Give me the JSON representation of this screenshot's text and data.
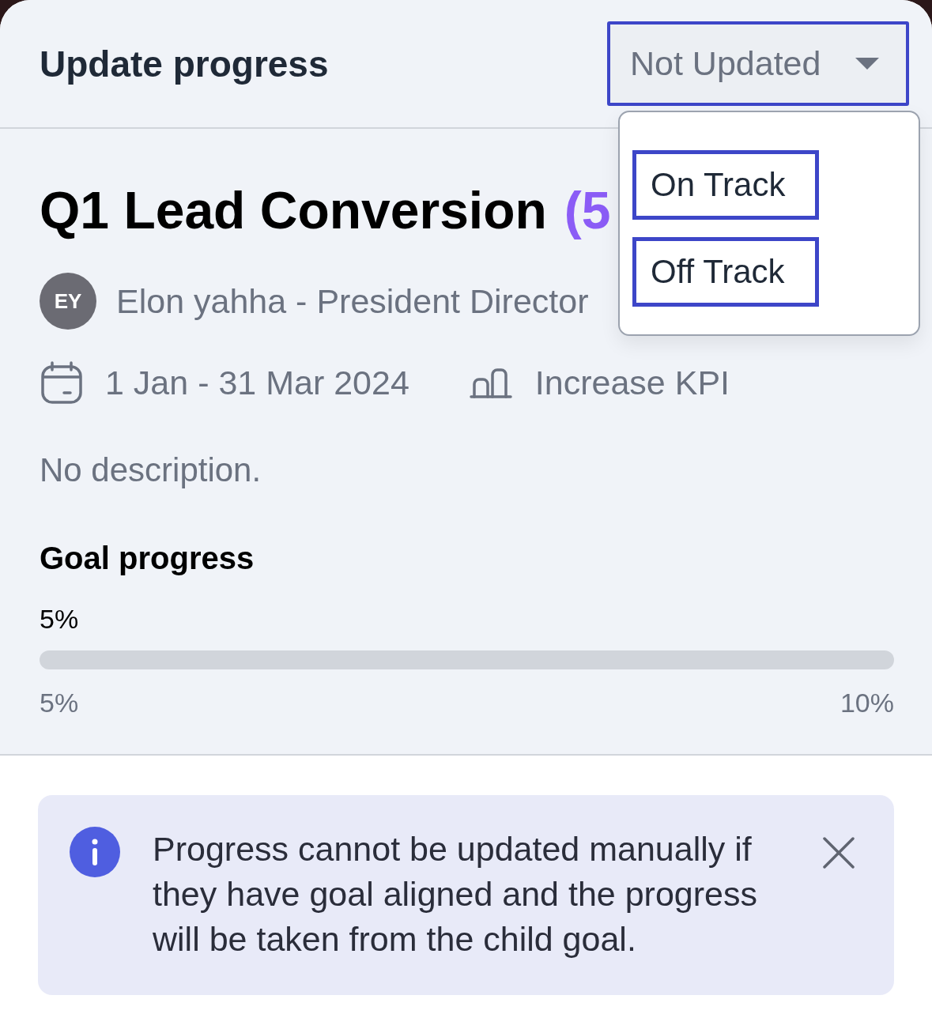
{
  "header": {
    "title": "Update progress"
  },
  "status_select": {
    "value": "Not Updated",
    "expanded": true,
    "options": [
      {
        "label": "On Track"
      },
      {
        "label": "Off Track"
      }
    ]
  },
  "goal": {
    "title": "Q1 Lead Conversion",
    "title_suffix": "(5",
    "owner": {
      "initials": "EY",
      "name": "Elon yahha - President Director"
    },
    "period": "1 Jan - 31 Mar 2024",
    "kpi": "Increase KPI",
    "description": "No description."
  },
  "progress": {
    "heading": "Goal progress",
    "current": "5%",
    "min_label": "5%",
    "max_label": "10%"
  },
  "notice": {
    "text": "Progress cannot be updated manually if they have goal aligned and the progress will be taken from the child goal."
  }
}
